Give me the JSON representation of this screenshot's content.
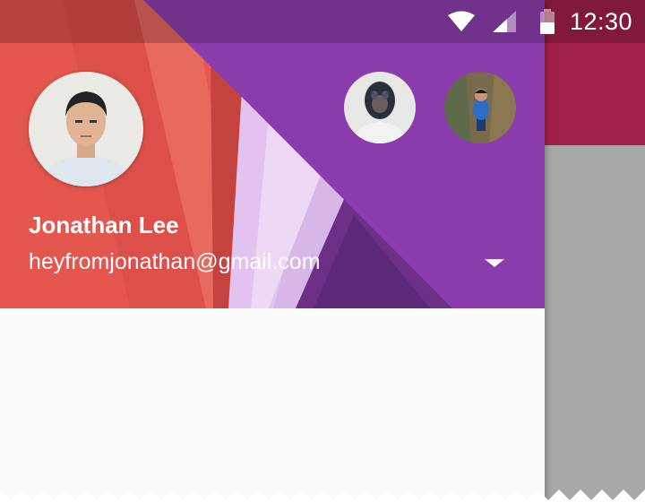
{
  "status_bar": {
    "time": "12:30",
    "icons": [
      "wifi-icon",
      "cell-signal-icon",
      "battery-icon"
    ]
  },
  "drawer": {
    "header": {
      "account_name": "Jonathan Lee",
      "account_email": "heyfromjonathan@gmail.com",
      "dropdown_icon": "arrow-drop-down-icon"
    },
    "avatars": [
      "current-account-avatar",
      "other-account-avatar-1",
      "other-account-avatar-2"
    ]
  },
  "colors": {
    "status_bar_overlay": "rgba(0,0,0,0.20)",
    "header_red": "#e0524c",
    "header_purple": "#8e3fb0",
    "background_app_bar": "#a0204a",
    "drawer_body": "#fafafa",
    "scrim": "#a8a8a8"
  }
}
